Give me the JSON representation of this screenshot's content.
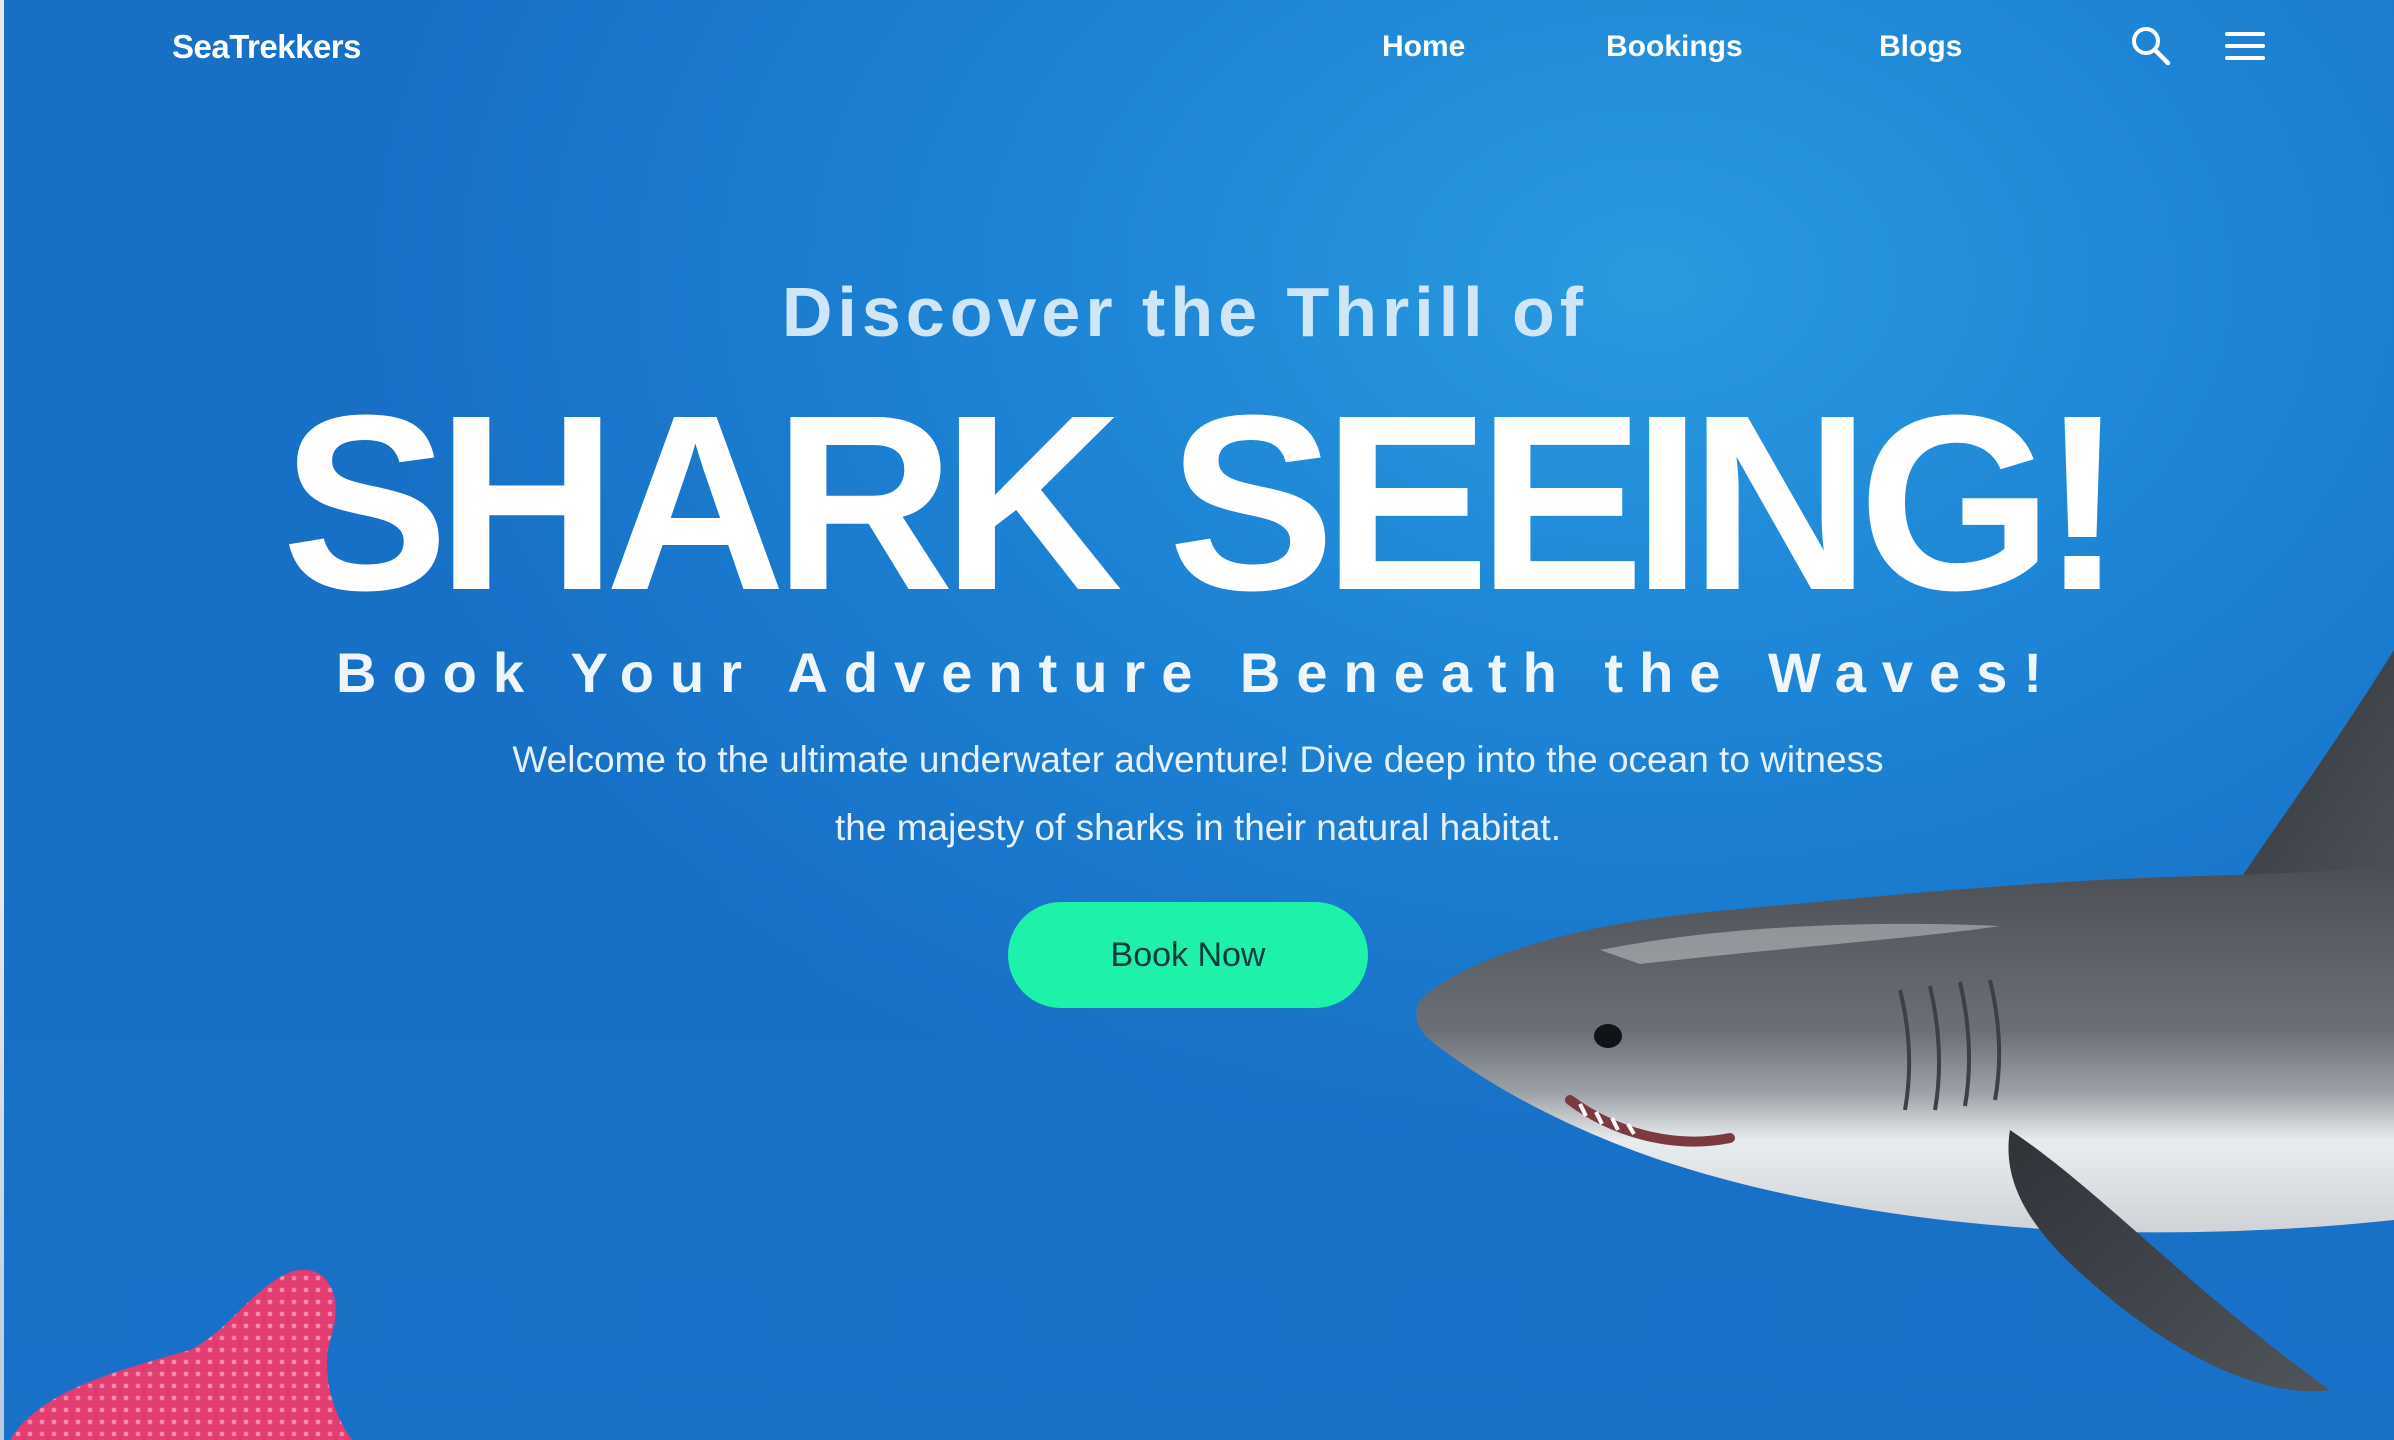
{
  "nav": {
    "brand": "SeaTrekkers",
    "links": [
      {
        "label": "Home"
      },
      {
        "label": "Bookings"
      },
      {
        "label": "Blogs"
      }
    ],
    "icons": [
      "search-icon",
      "menu-icon"
    ]
  },
  "hero": {
    "kicker": "Discover the Thrill of",
    "title": "SHARK SEEING!",
    "subtitle": "Book Your Adventure Beneath the Waves!",
    "description": "Welcome to the ultimate underwater adventure! Dive deep into the ocean to witness the majesty of sharks in their natural habitat.",
    "cta_label": "Book Now"
  },
  "colors": {
    "background": "#1e85d6",
    "accent": "#1ef2aa",
    "text": "#ffffff"
  }
}
